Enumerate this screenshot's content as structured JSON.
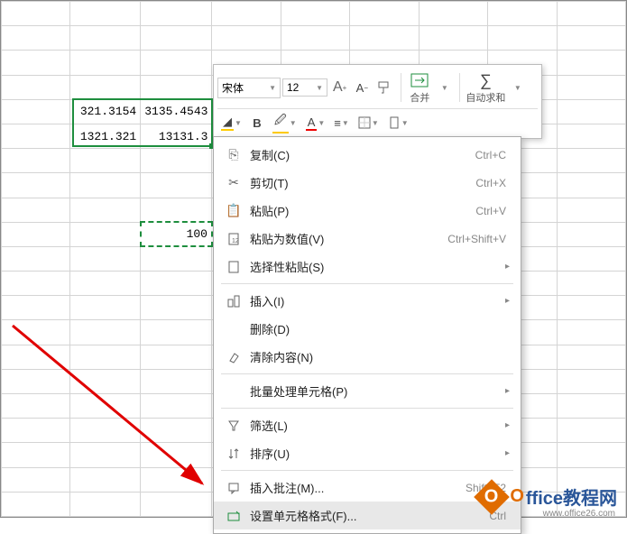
{
  "cells": {
    "a1": "321.3154",
    "b1": "3135.4543",
    "a2": "1321.321",
    "b2": "13131.3",
    "dashed": "100"
  },
  "toolbar": {
    "font_name": "宋体",
    "font_size": "12",
    "inc_font": "A",
    "dec_font": "A",
    "merge_label": "合并",
    "autosum_label": "自动求和",
    "bold": "B",
    "align": "≡",
    "font_color": "A",
    "fill_glyph": "◢"
  },
  "menu": {
    "copy": {
      "label": "复制(C)",
      "shortcut": "Ctrl+C"
    },
    "cut": {
      "label": "剪切(T)",
      "shortcut": "Ctrl+X"
    },
    "paste": {
      "label": "粘贴(P)",
      "shortcut": "Ctrl+V"
    },
    "paste_values": {
      "label": "粘贴为数值(V)",
      "shortcut": "Ctrl+Shift+V"
    },
    "paste_special": {
      "label": "选择性粘贴(S)"
    },
    "insert": {
      "label": "插入(I)"
    },
    "delete": {
      "label": "删除(D)"
    },
    "clear": {
      "label": "清除内容(N)"
    },
    "batch": {
      "label": "批量处理单元格(P)"
    },
    "filter": {
      "label": "筛选(L)"
    },
    "sort": {
      "label": "排序(U)"
    },
    "comment": {
      "label": "插入批注(M)...",
      "shortcut": "Shift+F2"
    },
    "format": {
      "label": "设置单元格格式(F)...",
      "shortcut": "Ctrl"
    }
  },
  "watermark": {
    "badge": "O",
    "text1": "O",
    "text2": "ffice教程网",
    "url": "www.office26.com"
  }
}
